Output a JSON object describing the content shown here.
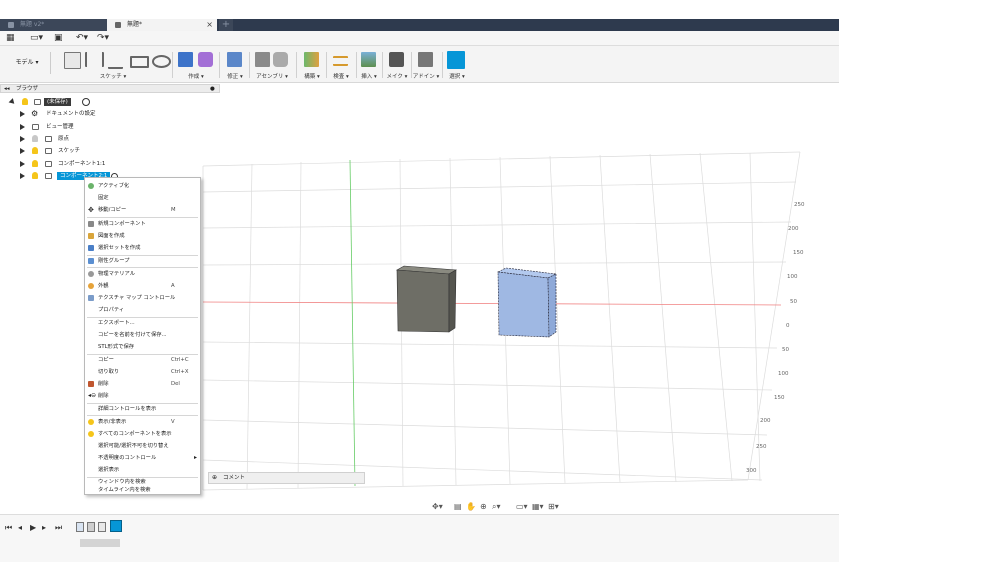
{
  "tabs": [
    {
      "label": "無題 v2*"
    },
    {
      "label": "無題*"
    }
  ],
  "toolbar": {
    "workspace": "モデル ▾",
    "groups": [
      {
        "label": "スケッチ ▾"
      },
      {
        "label": "作成 ▾"
      },
      {
        "label": "修正 ▾"
      },
      {
        "label": "アセンブリ ▾"
      },
      {
        "label": "構築 ▾"
      },
      {
        "label": "検査 ▾"
      },
      {
        "label": "挿入 ▾"
      },
      {
        "label": "メイク ▾"
      },
      {
        "label": "アドイン ▾"
      },
      {
        "label": "選択 ▾"
      }
    ]
  },
  "browser": {
    "title": "ブラウザ",
    "root": "(未保存)",
    "items": [
      {
        "label": "ドキュメントの設定"
      },
      {
        "label": "ビュー管理"
      },
      {
        "label": "原点"
      },
      {
        "label": "スケッチ"
      },
      {
        "label": "コンポーネント1:1"
      },
      {
        "label": "コンポーネント2:1"
      }
    ]
  },
  "context_menu": {
    "items": [
      {
        "label": "アクティブ化",
        "shortcut": ""
      },
      {
        "label": "固定",
        "shortcut": ""
      },
      {
        "label": "移動/コピー",
        "shortcut": "M"
      },
      {
        "label": "新規コンポーネント",
        "shortcut": ""
      },
      {
        "label": "図面を作成",
        "shortcut": ""
      },
      {
        "label": "選択セットを作成",
        "shortcut": ""
      },
      {
        "label": "剛性グループ",
        "shortcut": ""
      },
      {
        "label": "物理マテリアル",
        "shortcut": ""
      },
      {
        "label": "外観",
        "shortcut": "A"
      },
      {
        "label": "テクスチャ マップ コントロール",
        "shortcut": ""
      },
      {
        "label": "プロパティ",
        "shortcut": ""
      },
      {
        "label": "エクスポート...",
        "shortcut": ""
      },
      {
        "label": "コピーを名前を付けて保存...",
        "shortcut": ""
      },
      {
        "label": "STL形式で保存",
        "shortcut": ""
      },
      {
        "label": "コピー",
        "shortcut": "Ctrl+C"
      },
      {
        "label": "切り取り",
        "shortcut": "Ctrl+X"
      },
      {
        "label": "削除",
        "shortcut": "Del"
      },
      {
        "label": "削除",
        "shortcut": ""
      },
      {
        "label": "詳細コントロールを表示",
        "shortcut": ""
      },
      {
        "label": "表示/非表示",
        "shortcut": "V"
      },
      {
        "label": "すべてのコンポーネントを表示",
        "shortcut": ""
      },
      {
        "label": "選択可能/選択不可を切り替え",
        "shortcut": ""
      },
      {
        "label": "不透明度のコントロール",
        "shortcut": ""
      },
      {
        "label": "選択表示",
        "shortcut": ""
      },
      {
        "label": "ウィンドウ内を検索",
        "shortcut": ""
      },
      {
        "label": "タイムライン内を検索",
        "shortcut": ""
      }
    ]
  },
  "ruler_labels": [
    "250",
    "200",
    "150",
    "100",
    "50",
    "0",
    "50",
    "100",
    "150",
    "200",
    "250",
    "300"
  ],
  "comment_label": "コメント",
  "colors": {
    "tab_bar": "#2e3a4e",
    "select_highlight": "#0696d7",
    "selected_cube": "#9fb8e3",
    "gray_cube": "#6e6e66",
    "grid_line": "#dcdcdc",
    "x_axis": "#f08080",
    "y_axis": "#66cc66"
  }
}
